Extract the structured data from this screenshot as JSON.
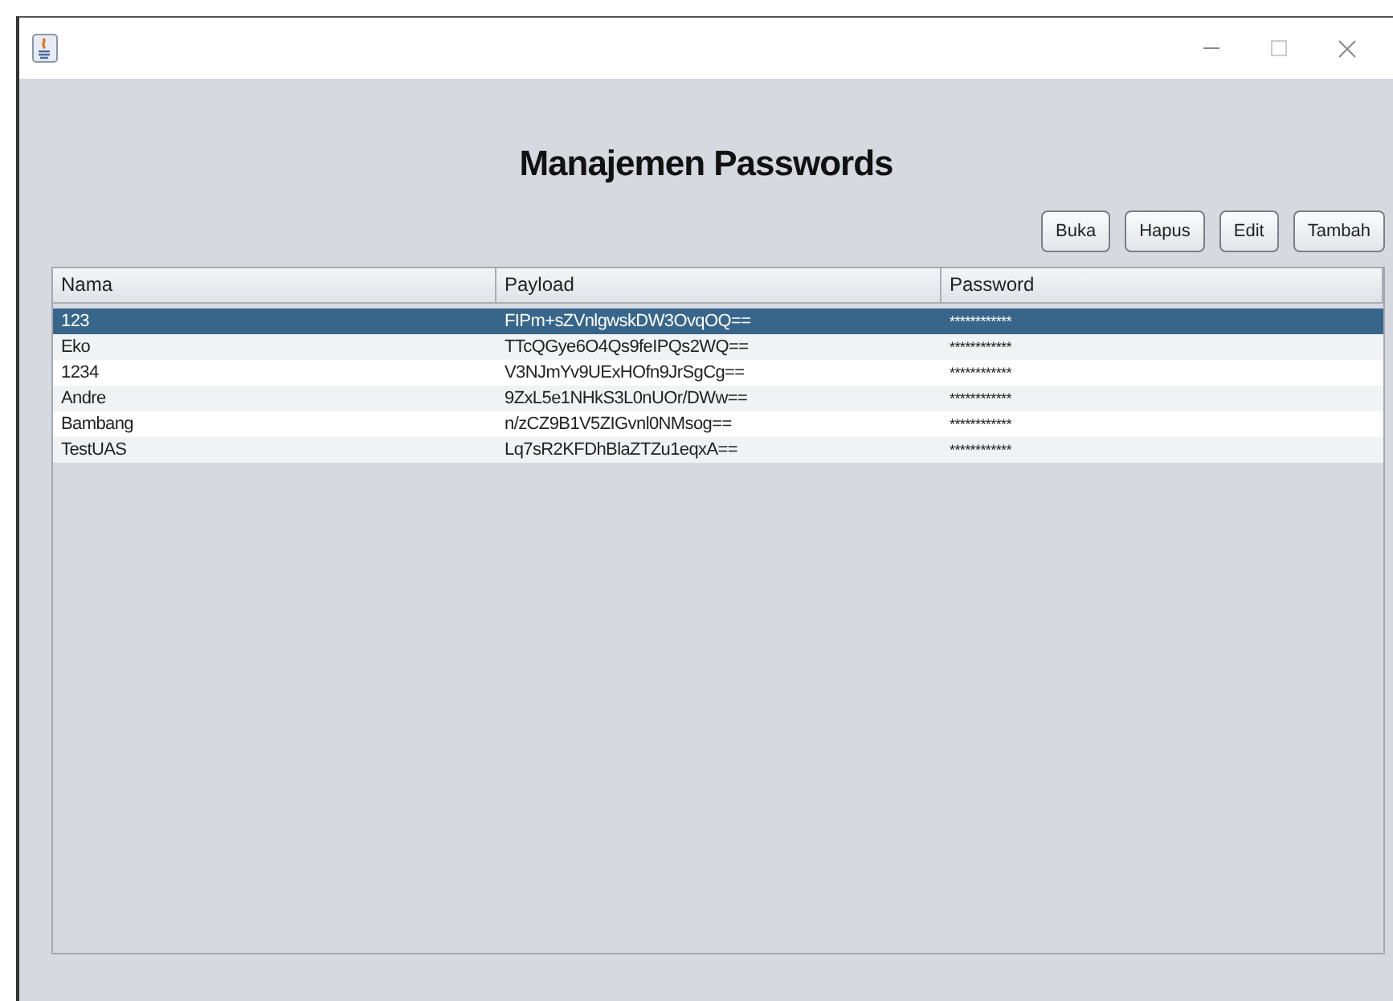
{
  "window": {
    "title": "Manajemen Passwords"
  },
  "buttons": [
    "Buka",
    "Hapus",
    "Edit",
    "Tambah"
  ],
  "table": {
    "columns": [
      "Nama",
      "Payload",
      "Password"
    ],
    "rows": [
      {
        "cells": [
          "123",
          "FIPm+sZVnlgwskDW3OvqOQ==",
          "************"
        ],
        "selected": true
      },
      {
        "cells": [
          "Eko",
          "TTcQGye6O4Qs9feIPQs2WQ==",
          "************"
        ],
        "selected": false
      },
      {
        "cells": [
          "1234",
          "V3NJmYv9UExHOfn9JrSgCg==",
          "************"
        ],
        "selected": false
      },
      {
        "cells": [
          "Andre",
          "9ZxL5e1NHkS3L0nUOr/DWw==",
          "************"
        ],
        "selected": false
      },
      {
        "cells": [
          "Bambang",
          "n/zCZ9B1V5ZIGvnl0NMsog==",
          "************"
        ],
        "selected": false
      },
      {
        "cells": [
          "TestUAS",
          "Lq7sR2KFDhBlaZTZu1eqxA==",
          "************"
        ],
        "selected": false
      }
    ]
  }
}
